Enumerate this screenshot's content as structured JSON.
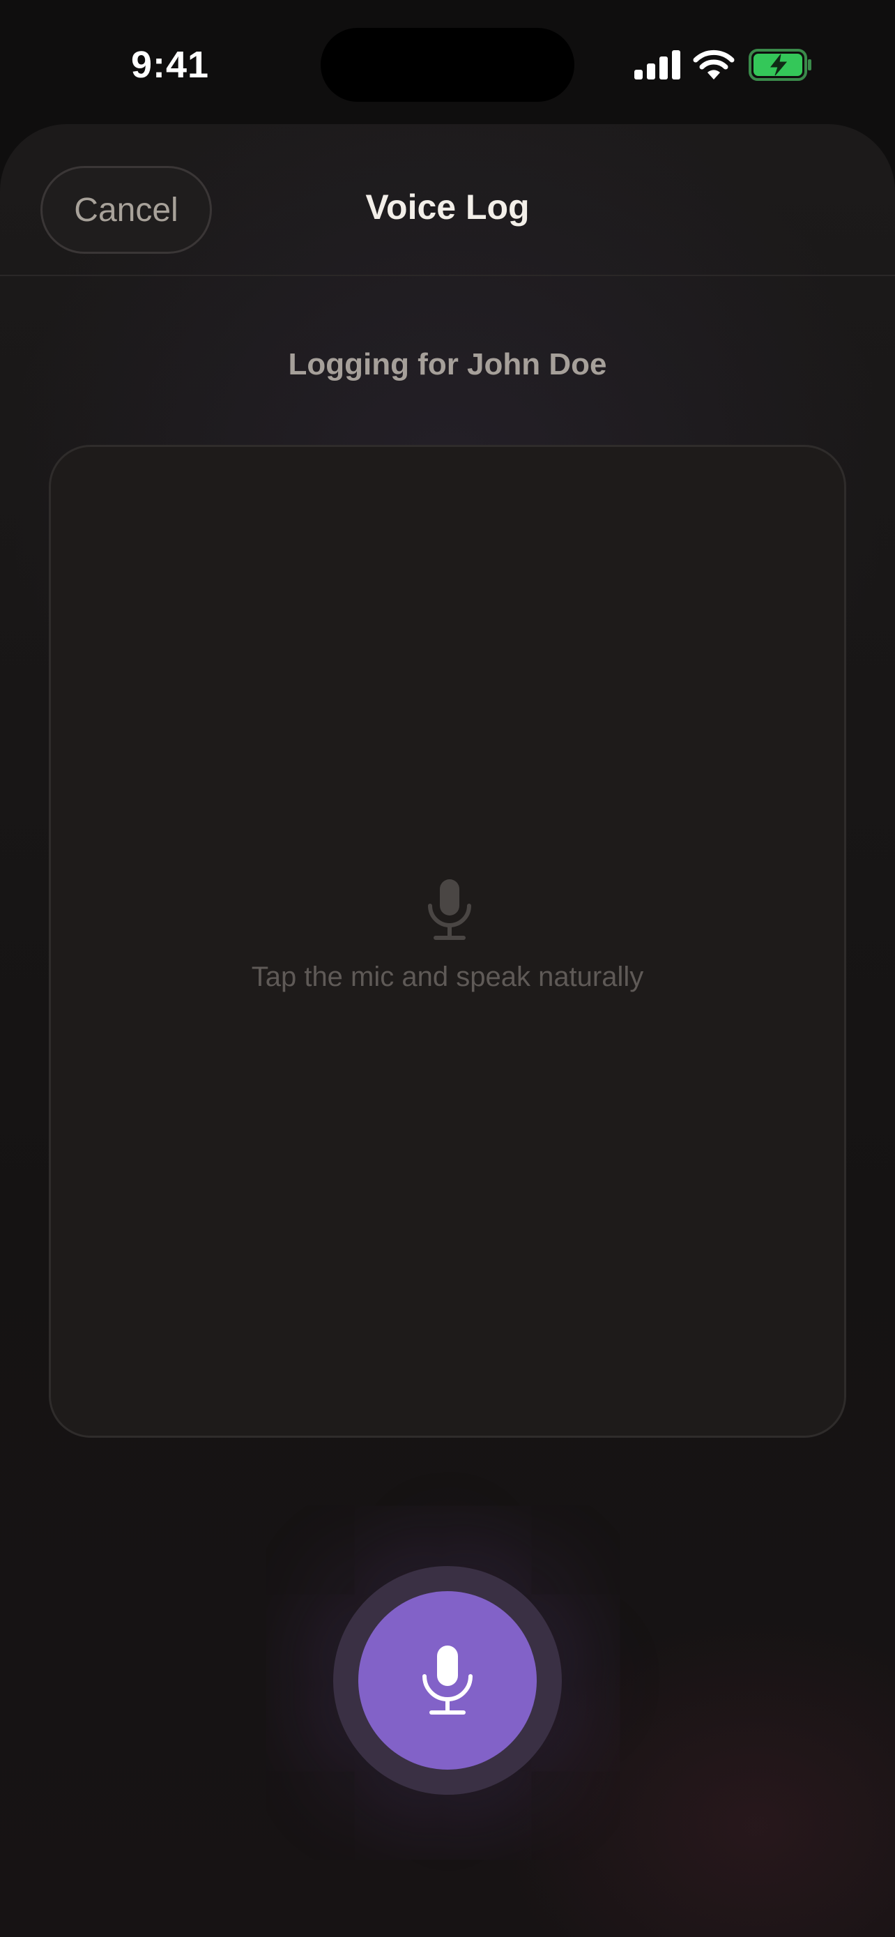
{
  "status_bar": {
    "time": "9:41"
  },
  "header": {
    "cancel_label": "Cancel",
    "title": "Voice Log"
  },
  "context": {
    "logging_for": "Logging for John Doe"
  },
  "transcript": {
    "placeholder_hint": "Tap the mic and speak naturally"
  },
  "icons": {
    "card": "microphone-icon",
    "record": "microphone-icon"
  },
  "colors": {
    "accent": "#8262c8",
    "battery": "#34c759"
  }
}
